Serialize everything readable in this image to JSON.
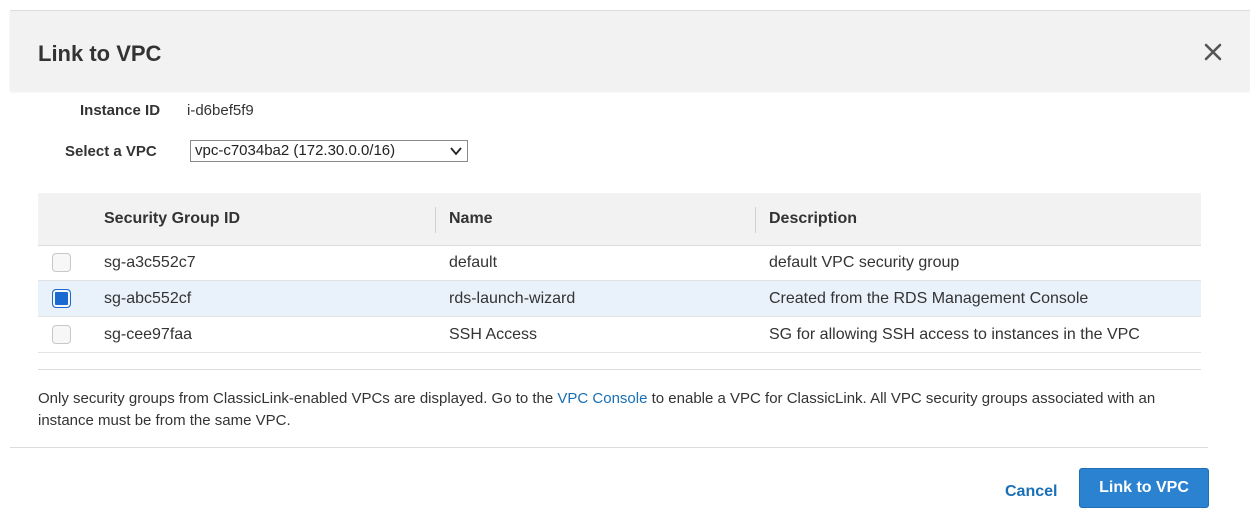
{
  "dialog": {
    "title": "Link to VPC",
    "close_icon": "close-icon"
  },
  "form": {
    "instance_id_label": "Instance ID",
    "instance_id_value": "i-d6bef5f9",
    "vpc_label": "Select a VPC",
    "vpc_selected": "vpc-c7034ba2 (172.30.0.0/16)"
  },
  "table": {
    "columns": [
      "Security Group ID",
      "Name",
      "Description"
    ],
    "rows": [
      {
        "checked": false,
        "id": "sg-a3c552c7",
        "name": "default",
        "description": "default VPC security group"
      },
      {
        "checked": true,
        "id": "sg-abc552cf",
        "name": "rds-launch-wizard",
        "description": "Created from the RDS Management Console"
      },
      {
        "checked": false,
        "id": "sg-cee97faa",
        "name": "SSH Access",
        "description": "SG for allowing SSH access to instances in the VPC"
      }
    ]
  },
  "note": {
    "before": "Only security groups from ClassicLink-enabled VPCs are displayed. Go to the ",
    "link": "VPC Console",
    "after": " to enable a VPC for ClassicLink. All VPC security groups associated with an instance must be from the same VPC."
  },
  "footer": {
    "cancel_label": "Cancel",
    "primary_label": "Link to VPC"
  },
  "colors": {
    "accent": "#2b82d1",
    "link": "#1a6fb5",
    "selected_row": "#e9f1fb"
  }
}
